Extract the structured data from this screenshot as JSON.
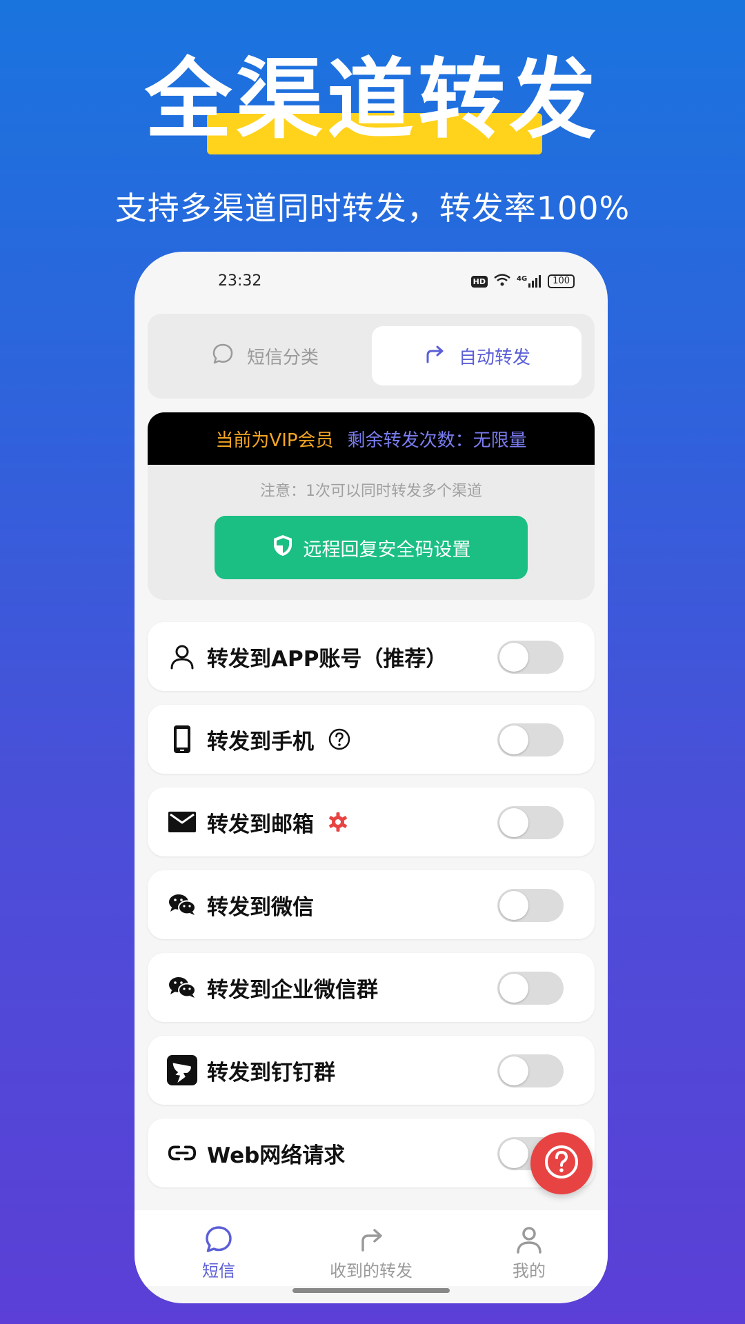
{
  "banner": {
    "title": "全渠道转发",
    "subtitle": "支持多渠道同时转发，转发率100%"
  },
  "status_bar": {
    "time": "23:32",
    "hd": "HD",
    "network": "4G",
    "battery": "100"
  },
  "segment": {
    "left_label": "短信分类",
    "right_label": "自动转发",
    "selected": "自动转发"
  },
  "vip": {
    "status": "当前为VIP会员",
    "remaining": "剩余转发次数：无限量",
    "notice": "注意：1次可以同时转发多个渠道",
    "safe_button": "远程回复安全码设置"
  },
  "channels": [
    {
      "label": "转发到APP账号（推荐）",
      "icon": "person-icon",
      "enabled": false
    },
    {
      "label": "转发到手机",
      "icon": "phone-icon",
      "extra": "help-circle-icon",
      "enabled": false
    },
    {
      "label": "转发到邮箱",
      "icon": "mail-icon",
      "extra": "gear-icon",
      "enabled": false
    },
    {
      "label": "转发到微信",
      "icon": "wechat-icon",
      "enabled": false
    },
    {
      "label": "转发到企业微信群",
      "icon": "wechat-icon",
      "enabled": false
    },
    {
      "label": "转发到钉钉群",
      "icon": "dingtalk-icon",
      "enabled": false
    },
    {
      "label": "Web网络请求",
      "icon": "link-icon",
      "enabled": false
    }
  ],
  "tabs": [
    {
      "label": "短信",
      "icon": "chat-bubble-icon",
      "active": true
    },
    {
      "label": "收到的转发",
      "icon": "forward-arrow-icon",
      "active": false
    },
    {
      "label": "我的",
      "icon": "person-icon",
      "active": false
    }
  ],
  "colors": {
    "accent": "#5b5fd6",
    "vip_gold": "#f5a623",
    "safe_green": "#1bbf83",
    "fab_red": "#e84343",
    "highlight_yellow": "#ffd21c"
  }
}
